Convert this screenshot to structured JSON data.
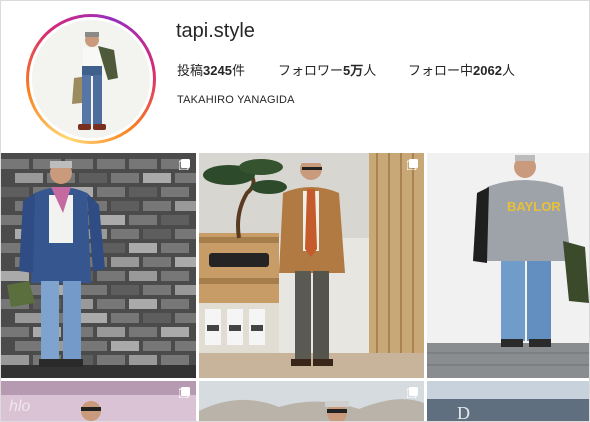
{
  "profile": {
    "username": "tapi.style",
    "full_name": "TAKAHIRO YANAGIDA",
    "stats": {
      "posts_label": "投稿",
      "posts_value": "3245",
      "posts_unit": "件",
      "followers_label": "フォロワー",
      "followers_value": "5万",
      "followers_unit": "人",
      "following_label": "フォロー中",
      "following_value": "2062",
      "following_unit": "人"
    },
    "story_ring_colors": [
      "#feda75",
      "#fa7e1e",
      "#d62976",
      "#962fbf"
    ]
  },
  "grid": {
    "posts": [
      {
        "icon": "multiple-photos-icon",
        "background": "brick-wall"
      },
      {
        "icon": "multiple-photos-icon",
        "background": "bonsai-shop"
      },
      {
        "icon": "multiple-photos-icon",
        "background": "white-wall"
      },
      {
        "icon": "multiple-photos-icon",
        "background": "pink-storefront"
      },
      {
        "icon": "multiple-photos-icon",
        "background": "outdoor-trees"
      },
      {
        "icon": "multiple-photos-icon",
        "background": "building-sign"
      }
    ]
  }
}
